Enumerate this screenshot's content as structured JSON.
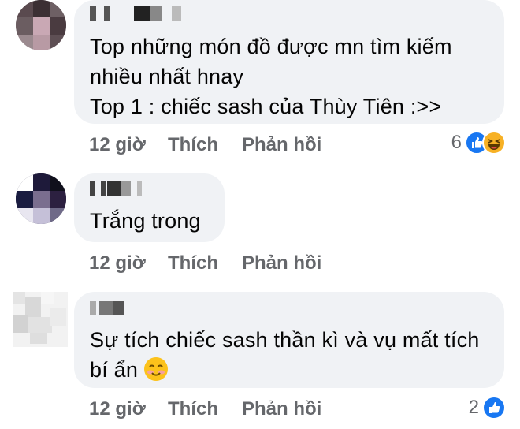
{
  "comments": [
    {
      "lines": [
        "Top những món đồ được mn tìm kiếm",
        "nhiều nhất hnay",
        "Top 1 : chiếc sash của Thùy Tiên :>>"
      ],
      "time": "12 giờ",
      "like_label": "Thích",
      "reply_label": "Phản hồi",
      "reaction_count": "6",
      "reactions": [
        "like-icon",
        "haha-icon"
      ]
    },
    {
      "lines": [
        "Trắng trong"
      ],
      "time": "12 giờ",
      "like_label": "Thích",
      "reply_label": "Phản hồi"
    },
    {
      "lines": [
        "Sự tích chiếc sash thần kì và vụ mất tích",
        "bí ẩn"
      ],
      "inline_emoji": "smiling-face-icon",
      "time": "12 giờ",
      "like_label": "Thích",
      "reply_label": "Phản hồi",
      "reaction_count": "2",
      "reactions": [
        "like-icon"
      ]
    }
  ],
  "colors": {
    "bubble": "#f0f2f5",
    "text": "#050505",
    "secondary": "#65676b",
    "like": "#1877f2",
    "haha": "#f7b125"
  }
}
